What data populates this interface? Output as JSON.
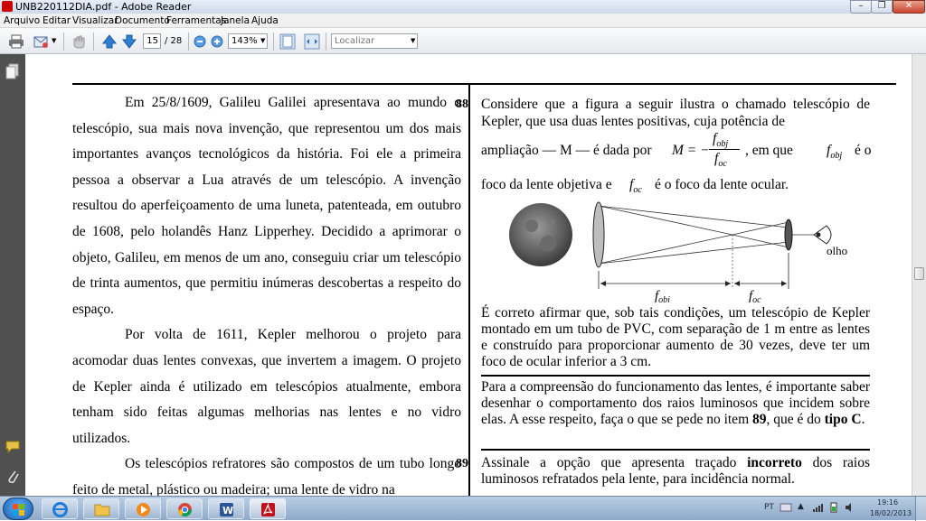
{
  "window": {
    "title": "UNB220112DIA.pdf - Adobe Reader"
  },
  "menu": [
    "Arquivo",
    "Editar",
    "Visualizar",
    "Documento",
    "Ferramentas",
    "Janela",
    "Ajuda"
  ],
  "toolbar": {
    "page_current": "15",
    "page_total": "/ 28",
    "zoom": "143%",
    "find_placeholder": "Localizar"
  },
  "doc": {
    "left_paragraphs": [
      "Em 25/8/1609, Galileu Galilei apresentava ao mundo o telescópio, sua mais nova invenção, que representou um dos mais importantes avanços tecnológicos da história. Foi ele a primeira pessoa a observar a Lua através de um telescópio. A invenção resultou do aperfeiçoamento de uma luneta, patenteada, em outubro de 1608, pelo holandês Hanz Lipperhey. Decidido a aprimorar o objeto, Galileu, em menos de um ano, conseguiu criar um telescópio de trinta aumentos, que permitiu inúmeras descobertas a respeito do espaço.",
      "Por volta de 1611, Kepler melhorou o projeto para acomodar duas lentes convexas, que invertem a imagem. O projeto de Kepler ainda é utilizado em telescópios atualmente, embora tenham sido feitas algumas melhorias nas lentes e no vidro utilizados.",
      "Os telescópios refratores são compostos de um tubo longo feito de metal, plástico ou madeira; uma lente de vidro na"
    ],
    "q88": {
      "number": "88",
      "line1": "Considere que a figura a seguir ilustra o chamado telescópio de Kepler, que usa duas lentes positivas, cuja potência de",
      "line2": "ampliação — M — é dada por",
      "formula_m": "M = −",
      "formula_num": "f",
      "formula_num_sub": "obj",
      "formula_den": "f",
      "formula_den_sub": "oc",
      "line2_end": ", em que",
      "fobj": "f",
      "fobj_sub": "obj",
      "line2_tail": "é o",
      "line3a": "foco da lente objetiva e",
      "foc": "f",
      "foc_sub": "oc",
      "line3b": "é o foco da lente ocular.",
      "fig_label_eye": "olho",
      "fig_label_fobj": "f",
      "fig_label_fobj_sub": "obj",
      "fig_label_foc": "f",
      "fig_label_foc_sub": "oc",
      "statement": "É correto afirmar que, sob tais condições, um telescópio de Kepler montado em um tubo de PVC, com separação de 1 m entre as lentes e construído para proporcionar aumento de 30 vezes, deve ter um foco de ocular inferior a 3 cm."
    },
    "intro89": {
      "text": "Para a compreensão do funcionamento das lentes, é importante saber desenhar o comportamento dos raios luminosos que incidem sobre elas. A esse respeito, faça o que se pede no item",
      "item": "89",
      "mid": ", que é do",
      "tipo": "tipo C",
      "end": "."
    },
    "q89": {
      "number": "89",
      "a": "Assinale a opção que apresenta traçado",
      "bold": "incorreto",
      "b": "dos raios luminosos refratados pela lente, para incidência normal."
    }
  },
  "taskbar": {
    "lang": "PT",
    "time": "19:16",
    "date": "18/02/2013"
  }
}
